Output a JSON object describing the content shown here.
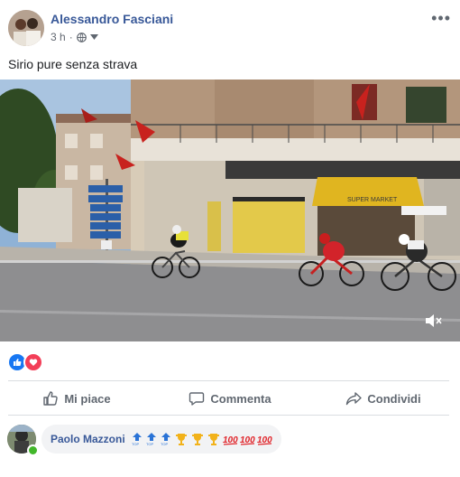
{
  "post": {
    "author": "Alessandro Fasciani",
    "time": "3 h",
    "privacy_icon": "globe-icon",
    "more_icon": "more-icon",
    "text": "Sirio pure senza strava"
  },
  "video": {
    "mute_icon": "volume-mute-icon",
    "signs": [
      "Caserta",
      "Ascoli Piceno",
      "MACERATA",
      "MANTOVA",
      "VENTIMIGLIA",
      "FERMO",
      "PORTO S.GIORGIO"
    ],
    "shop_sign": "SUPER MARKET"
  },
  "reactions": [
    "like",
    "love"
  ],
  "actions": {
    "like": "Mi piace",
    "comment": "Commenta",
    "share": "Condividi"
  },
  "comment": {
    "author": "Paolo Mazzoni",
    "emojis": [
      "top-arrow",
      "top-arrow",
      "top-arrow",
      "trophy",
      "trophy",
      "trophy",
      "100",
      "100",
      "100"
    ]
  },
  "colors": {
    "link": "#385898",
    "secondary": "#606770",
    "like_blue": "#1877f2",
    "love_red": "#f33e58"
  }
}
